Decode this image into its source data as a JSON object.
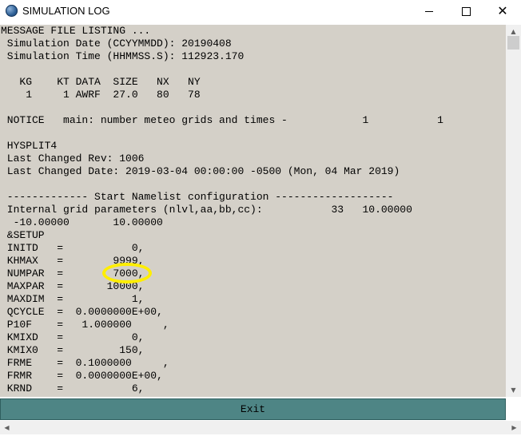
{
  "window": {
    "title": "SIMULATION LOG",
    "close_glyph": "✕",
    "icon": "globe-icon"
  },
  "log": {
    "lines": [
      "MESSAGE FILE LISTING ...",
      " Simulation Date (CCYYMMDD): 20190408",
      " Simulation Time (HHMMSS.S): 112923.170",
      "",
      "   KG    KT DATA  SIZE   NX   NY",
      "    1     1 AWRF  27.0   80   78",
      "",
      " NOTICE   main: number meteo grids and times -            1           1",
      "",
      " HYSPLIT4",
      " Last Changed Rev: 1006",
      " Last Changed Date: 2019-03-04 00:00:00 -0500 (Mon, 04 Mar 2019)",
      "",
      " ------------- Start Namelist configuration -------------------",
      " Internal grid parameters (nlvl,aa,bb,cc):           33   10.00000",
      "  -10.00000       10.00000",
      " &SETUP",
      " INITD   =           0,",
      " KHMAX   =        9999,",
      " NUMPAR  =        7000,",
      " MAXPAR  =       10000,",
      " MAXDIM  =           1,",
      " QCYCLE  =  0.0000000E+00,",
      " P10F    =   1.000000     ,",
      " KMIXD   =           0,",
      " KMIX0   =         150,",
      " FRME    =  0.1000000     ,",
      " FRMR    =  0.0000000E+00,",
      " KRND    =           6,"
    ]
  },
  "exit": {
    "label": "Exit"
  },
  "scroll": {
    "up": "▲",
    "down": "▼",
    "left": "◀",
    "right": "▶"
  }
}
